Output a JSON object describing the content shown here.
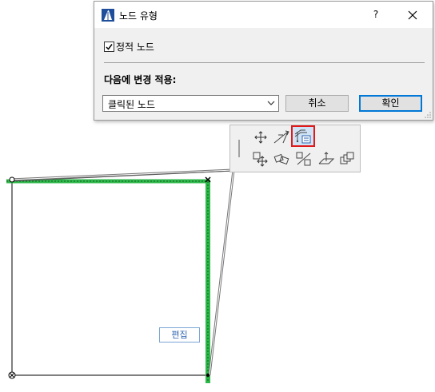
{
  "dialog": {
    "title": "노드 유형",
    "help_label": "?",
    "checkbox_label": "정적 노드",
    "checkbox_checked": true,
    "apply_section_label": "다음에 변경 적용:",
    "apply_select_value": "클릭된 노드",
    "cancel_label": "취소",
    "ok_label": "확인"
  },
  "canvas": {
    "edit_label": "편집"
  },
  "toolbar": {
    "icons": [
      "drag-icon",
      "elevation-icon",
      "node-type-icon",
      "move-copy-icon",
      "rotate-icon",
      "offset-icon",
      "mirror-plane-icon",
      "multiply-icon"
    ]
  },
  "colors": {
    "selection_green": "#2db84a",
    "selected_tool_border": "#e01a1a",
    "dialog_bg": "#f0f0f0",
    "ok_border": "#0078d7"
  }
}
